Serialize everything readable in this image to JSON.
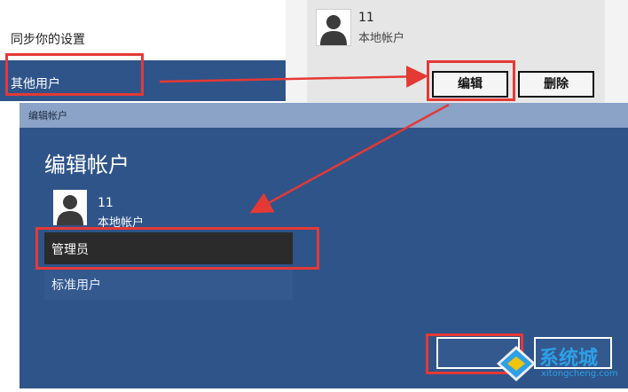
{
  "settings_nav": {
    "sync_settings_label": "同步你的设置",
    "other_users_label": "其他用户"
  },
  "account_card": {
    "name": "11",
    "type": "本地帐户",
    "edit_label": "编辑",
    "delete_label": "删除"
  },
  "dialog": {
    "window_title": "编辑帐户",
    "heading": "编辑帐户",
    "account_name": "11",
    "account_type": "本地帐户",
    "options": [
      {
        "label": "管理员",
        "selected": true
      },
      {
        "label": "标准用户",
        "selected": false
      }
    ]
  },
  "watermark": {
    "text": "系统城",
    "url": "xitongcheng.com"
  },
  "colors": {
    "accent_blue": "#2f5489",
    "selected_dark": "#2b2b2b",
    "annotation_red": "#e53935",
    "watermark_blue": "#2ea0e6"
  },
  "icons": [
    "user-avatar-icon",
    "watermark-logo-icon"
  ]
}
